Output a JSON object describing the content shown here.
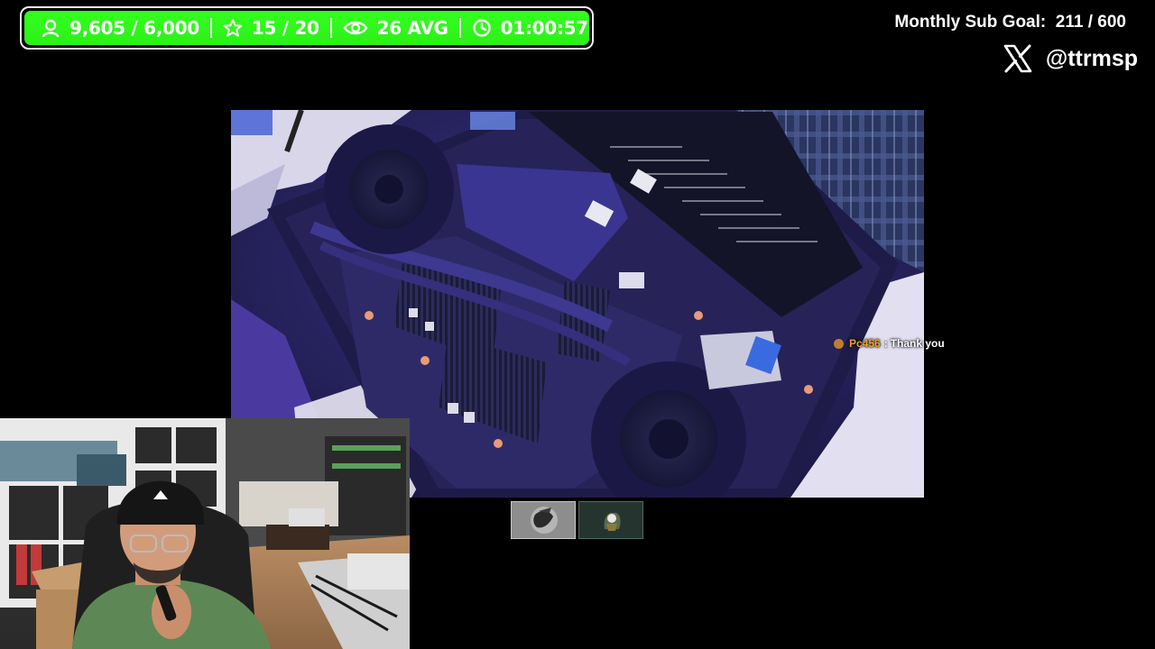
{
  "stats": {
    "followers": "9,605 / 6,000",
    "stars": "15 / 20",
    "viewers": "26 AVG",
    "uptime": "01:00:57"
  },
  "sub_goal": {
    "label": "Monthly Sub Goal:",
    "value": "211 / 600"
  },
  "social": {
    "handle": "@ttrmsp",
    "icon": "x-logo"
  },
  "chat": {
    "username": "Pc456",
    "separator": ":",
    "message": "Thank you"
  },
  "colors": {
    "stats_bar": "#33ff1e",
    "username": "#f0a028",
    "background": "#000000"
  }
}
